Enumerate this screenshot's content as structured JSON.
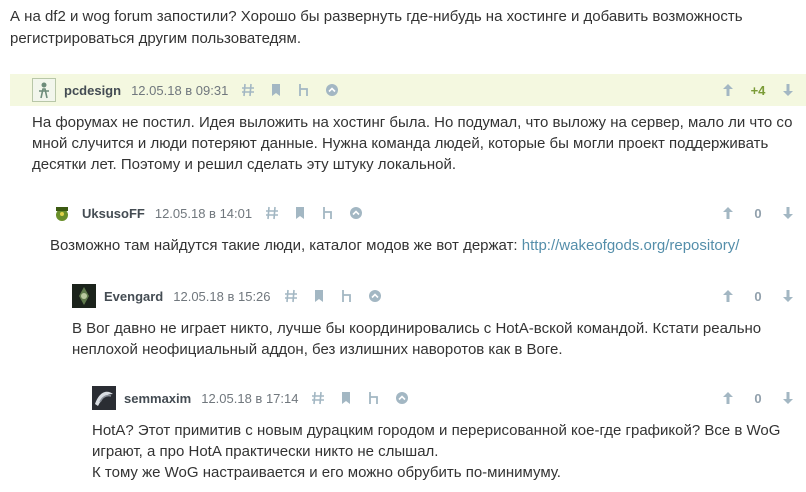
{
  "intro": "А на df2 и wog forum запостили? Хорошо бы развернуть где-нибудь на хостинге и добавить возможность регистрироваться другим пользоватедям.",
  "comments": [
    {
      "user": "pcdesign",
      "time": "12.05.18 в 09:31",
      "score": "+4",
      "text": "На форумах не постил. Идея выложить на хостинг была. Но подумал, что выложу на сервер, мало ли что со мной случится и люди потеряют данные. Нужна команда людей, которые бы могли проект поддерживать десятки лет. Поэтому и решил сделать эту штуку локальной."
    },
    {
      "user": "UksusoFF",
      "time": "12.05.18 в 14:01",
      "score": "0",
      "text": "Возможно там найдутся такие люди, каталог модов же вот держат: ",
      "link": "http://wakeofgods.org/repository/"
    },
    {
      "user": "Evengard",
      "time": "12.05.18 в 15:26",
      "score": "0",
      "text": "В Вог давно не играет никто, лучше бы координировались с HotA-вской командой. Кстати реально неплохой неофициальный аддон, без излишних наворотов как в Воге."
    },
    {
      "user": "semmaxim",
      "time": "12.05.18 в 17:14",
      "score": "0",
      "text": "HotA? Этот примитив с новым дурацким городом и перерисованной кое-где графикой? Все в WoG играют, а про HotA практически никто не слышал.",
      "text2": "К тому же WoG настраивается и его можно обрубить по-минимуму."
    }
  ],
  "colors": {
    "highlight": "#f4f8e0",
    "positive": "#7b9c37",
    "neutral": "#91a0ac",
    "link": "#548eaa",
    "icon": "#a3b7c3"
  },
  "icons": [
    "anchor-icon",
    "bookmark-icon",
    "parent-icon",
    "reply-icon",
    "upvote-icon",
    "downvote-icon"
  ]
}
